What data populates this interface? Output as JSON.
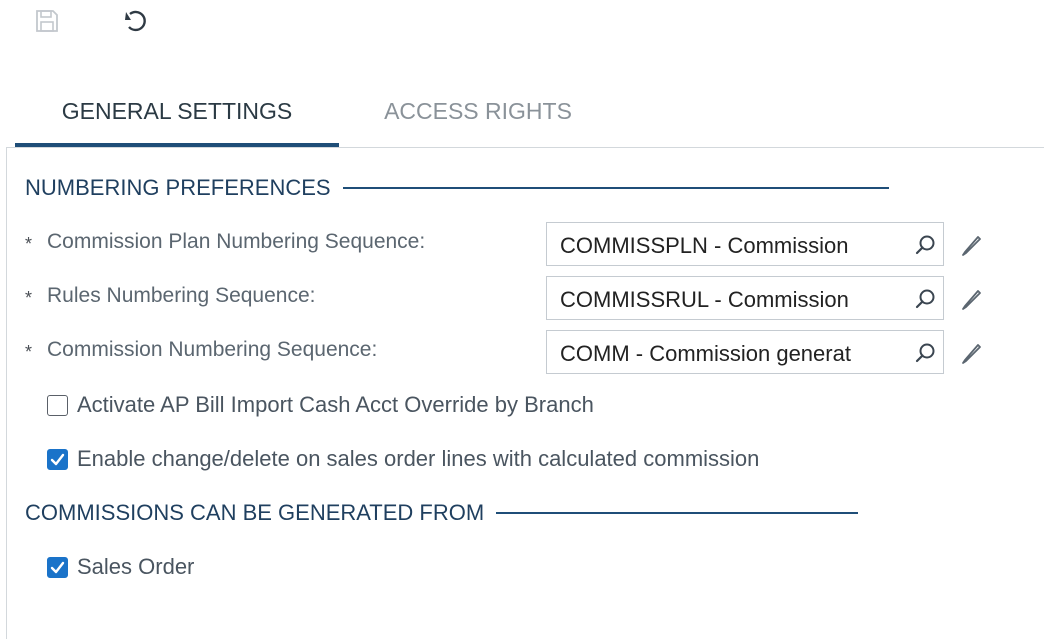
{
  "toolbar": {
    "save_icon": "save-icon",
    "undo_icon": "undo-icon"
  },
  "tabs": [
    {
      "label": "GENERAL SETTINGS",
      "active": true
    },
    {
      "label": "ACCESS RIGHTS",
      "active": false
    }
  ],
  "numbering_preferences": {
    "title": "NUMBERING PREFERENCES",
    "required_marker": "*",
    "fields": [
      {
        "label": "Commission Plan Numbering Sequence:",
        "value": "COMMISSPLN - Commission"
      },
      {
        "label": "Rules Numbering Sequence:",
        "value": "COMMISSRUL - Commission"
      },
      {
        "label": "Commission Numbering Sequence:",
        "value": "COMM - Commission generat"
      }
    ]
  },
  "checkboxes": [
    {
      "label": "Activate AP Bill Import Cash Acct Override by Branch",
      "checked": false
    },
    {
      "label": "Enable change/delete on sales order lines with calculated commission",
      "checked": true
    }
  ],
  "generated_from": {
    "title": "COMMISSIONS CAN BE GENERATED FROM",
    "checkboxes": [
      {
        "label": "Sales Order",
        "checked": true
      }
    ]
  },
  "colors": {
    "accent": "#1f4e78",
    "checkbox": "#1a73c9"
  }
}
